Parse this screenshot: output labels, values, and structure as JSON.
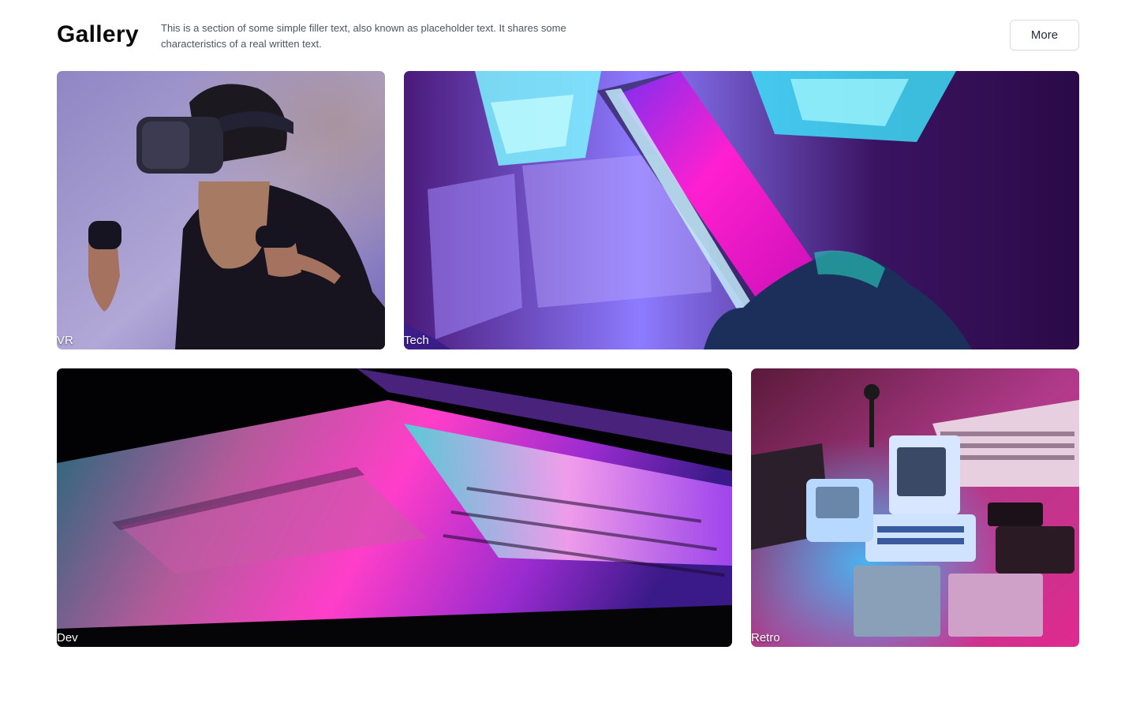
{
  "header": {
    "title": "Gallery",
    "description": "This is a section of some simple filler text, also known as placeholder text. It shares some characteristics of a real written text.",
    "more_label": "More"
  },
  "gallery": {
    "items": [
      {
        "label": "VR"
      },
      {
        "label": "Tech"
      },
      {
        "label": "Dev"
      },
      {
        "label": "Retro"
      }
    ]
  },
  "colors": {
    "magenta": "#ff1fd0",
    "cyan": "#3ee8ff",
    "violet": "#7a5cff",
    "deep_purple": "#2a0a4a"
  }
}
